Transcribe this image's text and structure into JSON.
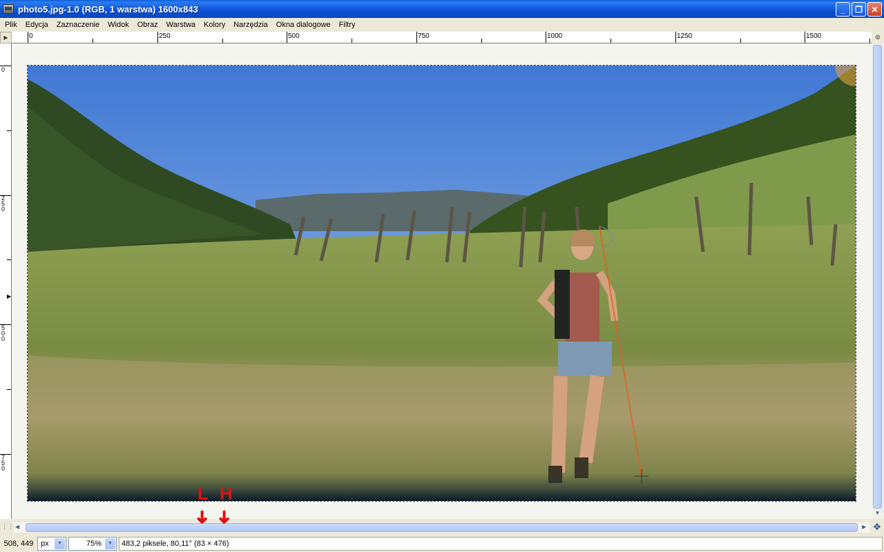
{
  "window": {
    "title": "photo5.jpg-1.0 (RGB, 1 warstwa) 1600x843",
    "min_label": "_",
    "max_label": "❐",
    "close_label": "✕"
  },
  "menu": {
    "items": [
      "Plik",
      "Edycja",
      "Zaznaczenie",
      "Widok",
      "Obraz",
      "Warstwa",
      "Kolory",
      "Narzędzia",
      "Okna dialogowe",
      "Filtry"
    ]
  },
  "rulers": {
    "horizontal_labels": [
      "0",
      "250",
      "500",
      "750",
      "1000",
      "1250",
      "1500"
    ],
    "vertical_labels": [
      "0",
      "250",
      "500",
      "750"
    ]
  },
  "statusbar": {
    "coords": "508, 449",
    "unit": "px",
    "zoom": "75%",
    "message": "483,2 piksele, 80,11° (83 × 476)"
  },
  "annotations": {
    "left_marker": "L",
    "right_marker": "H",
    "arrow": "➜"
  },
  "colors": {
    "titlebar": "#0b55d6",
    "annotation_red": "#e01010",
    "measure_line": "#e06020"
  }
}
